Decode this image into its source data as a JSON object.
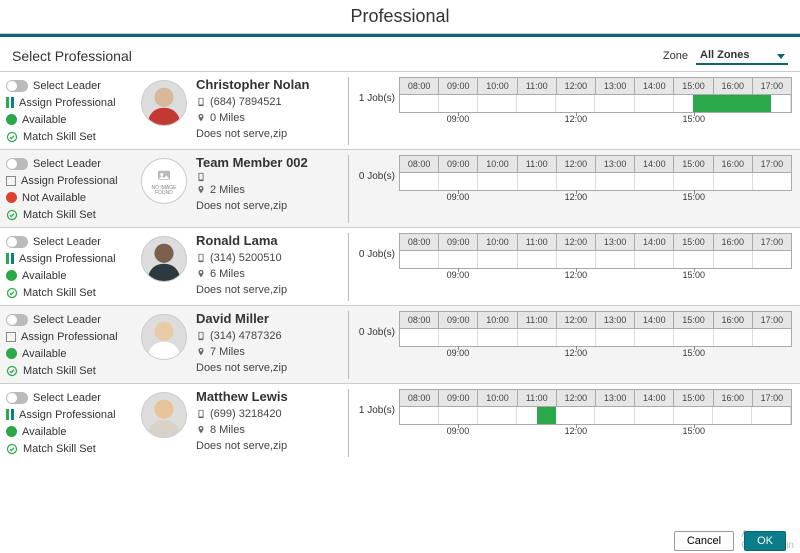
{
  "title": "Professional",
  "section_title": "Select Professional",
  "zone_label": "Zone",
  "zone_value": "All Zones",
  "labels": {
    "select_leader": "Select Leader",
    "assign_professional": "Assign Professional",
    "available": "Available",
    "not_available": "Not Available",
    "match_skill": "Match Skill Set"
  },
  "timeline": {
    "top_hours": [
      "08:00",
      "09:00",
      "10:00",
      "11:00",
      "12:00",
      "13:00",
      "14:00",
      "15:00",
      "16:00",
      "17:00"
    ],
    "bottom_hours": [
      "09:00",
      "12:00",
      "15:00"
    ]
  },
  "buttons": {
    "cancel": "Cancel",
    "ok": "OK"
  },
  "watermark": {
    "line1": "Activate",
    "line2": "Go to Settin"
  },
  "professionals": [
    {
      "name": "Christopher Nolan",
      "phone": "(684) 7894521",
      "miles": "0 Miles",
      "note": "Does not serve,zip",
      "jobs_label": "1 Job(s)",
      "available": true,
      "assign_icon": "bars",
      "avatar_type": "person",
      "avatar_colors": {
        "head": "#d8b89a",
        "body": "#c43832"
      },
      "blocks": [
        {
          "start_pct": 75,
          "end_pct": 95
        }
      ]
    },
    {
      "name": "Team Member 002",
      "phone": "",
      "miles": "2 Miles",
      "note": "Does not serve,zip",
      "jobs_label": "0 Job(s)",
      "available": false,
      "assign_icon": "square",
      "avatar_type": "noimage",
      "avatar_text": "NO IMAGE FOUND",
      "blocks": []
    },
    {
      "name": "Ronald Lama",
      "phone": "(314) 5200510",
      "miles": "6 Miles",
      "note": "Does not serve,zip",
      "jobs_label": "0 Job(s)",
      "available": true,
      "assign_icon": "bars",
      "avatar_type": "person",
      "avatar_colors": {
        "head": "#7a604d",
        "body": "#2b3a3e"
      },
      "blocks": []
    },
    {
      "name": "David Miller",
      "phone": "(314) 4787326",
      "miles": "7 Miles",
      "note": "Does not serve,zip",
      "jobs_label": "0 Job(s)",
      "available": true,
      "assign_icon": "square",
      "avatar_type": "person",
      "avatar_colors": {
        "head": "#eacba8",
        "body": "#ffffff"
      },
      "blocks": []
    },
    {
      "name": "Matthew Lewis",
      "phone": "(699) 3218420",
      "miles": "8 Miles",
      "note": "Does not serve,zip",
      "jobs_label": "1 Job(s)",
      "available": true,
      "assign_icon": "bars",
      "avatar_type": "person",
      "avatar_colors": {
        "head": "#e8c49a",
        "body": "#d9d2c8"
      },
      "blocks": [
        {
          "start_pct": 35,
          "end_pct": 40
        }
      ]
    }
  ]
}
